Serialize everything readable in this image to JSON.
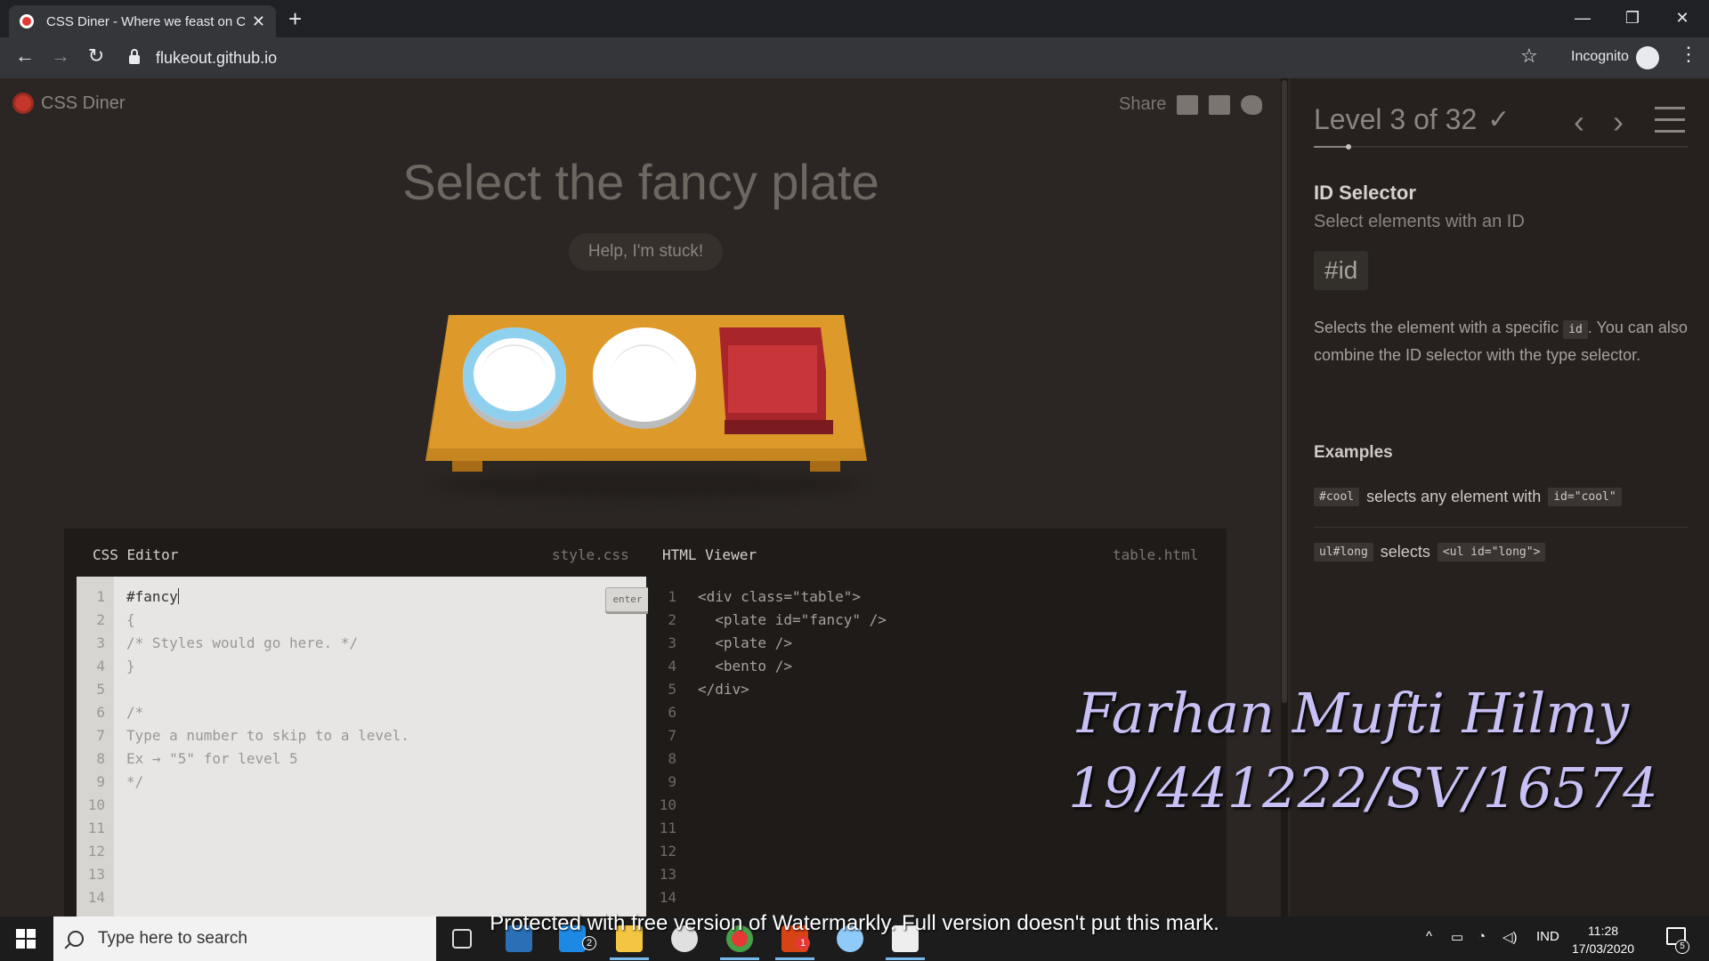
{
  "browser": {
    "tab_title": "CSS Diner - Where we feast on C",
    "url": "flukeout.github.io",
    "incognito_label": "Incognito"
  },
  "header": {
    "logo_text": "CSS Diner",
    "share_label": "Share"
  },
  "main": {
    "headline": "Select the fancy plate",
    "help_button": "Help, I'm stuck!"
  },
  "css_editor": {
    "title": "CSS Editor",
    "filename": "style.css",
    "enter_label": "enter",
    "input_value": "#fancy",
    "lines": [
      "{",
      "/* Styles would go here. */",
      "}",
      "",
      "/*",
      "Type a number to skip to a level.",
      "Ex → \"5\" for level 5",
      "*/",
      "",
      "",
      "",
      "",
      ""
    ],
    "line_numbers": [
      "1",
      "2",
      "3",
      "4",
      "5",
      "6",
      "7",
      "8",
      "9",
      "10",
      "11",
      "12",
      "13",
      "14"
    ]
  },
  "html_viewer": {
    "title": "HTML Viewer",
    "filename": "table.html",
    "lines": [
      "<div class=\"table\">",
      "  <plate id=\"fancy\" />",
      "  <plate />",
      "  <bento />",
      "</div>",
      "",
      "",
      "",
      "",
      "",
      "",
      "",
      "",
      ""
    ],
    "line_numbers": [
      "1",
      "2",
      "3",
      "4",
      "5",
      "6",
      "7",
      "8",
      "9",
      "10",
      "11",
      "12",
      "13",
      "14"
    ]
  },
  "sidebar": {
    "level_text": "Level 3 of 32",
    "level_progress": 0.0938,
    "selector_name": "ID Selector",
    "selector_subtitle": "Select elements with an ID",
    "syntax": "#id",
    "desc_before": "Selects the element with a specific ",
    "desc_code": "id",
    "desc_after": ". You can also combine the ID selector with the type selector.",
    "examples_heading": "Examples",
    "example1_code": "#cool",
    "example1_text": "selects any element with",
    "example1_code2": "id=\"cool\"",
    "example2_code": "ul#long",
    "example2_text": "selects",
    "example2_code2": "<ul id=\"long\">"
  },
  "overlay": {
    "name": "Farhan Mufti Hilmy",
    "id": "19/441222/SV/16574",
    "watermark": "Protected with free version of Watermarkly. Full version doesn't put this mark."
  },
  "taskbar": {
    "search_placeholder": "Type here to search",
    "mail_badge": "2",
    "app_badge": "1",
    "lang": "IND",
    "time": "11:28",
    "date": "17/03/2020",
    "notif_count": "5"
  }
}
